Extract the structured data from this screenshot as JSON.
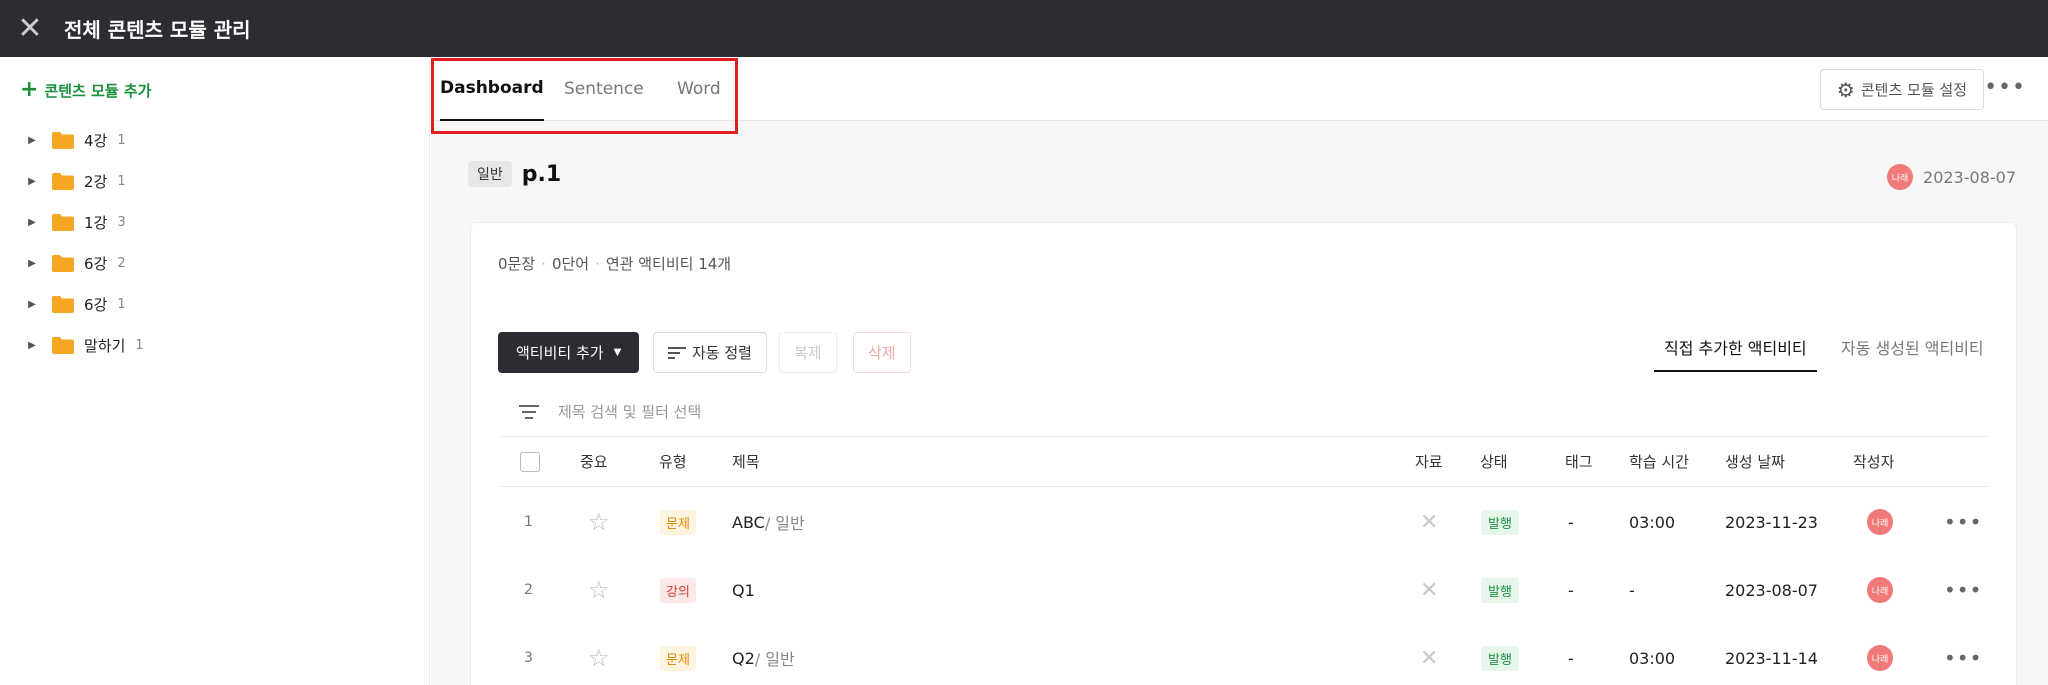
{
  "topbar": {
    "title": "전체 콘텐츠 모듈 관리",
    "close_icon": "close-icon"
  },
  "sidebar": {
    "add_label": "콘텐츠 모듈 추가",
    "items": [
      {
        "label": "4강",
        "count": "1"
      },
      {
        "label": "2강",
        "count": "1"
      },
      {
        "label": "1강",
        "count": "3"
      },
      {
        "label": "6강",
        "count": "2"
      },
      {
        "label": "6강",
        "count": "1"
      },
      {
        "label": "말하기",
        "count": "1"
      }
    ]
  },
  "tabs": [
    {
      "label": "Dashboard",
      "active": true
    },
    {
      "label": "Sentence",
      "active": false
    },
    {
      "label": "Word",
      "active": false
    }
  ],
  "header": {
    "settings_label": "콘텐츠 모듈 설정",
    "badge": "일반",
    "title": "p.1",
    "author_avatar": "나래",
    "date": "2023-08-07"
  },
  "stats": {
    "sentences": "0문장",
    "words": "0단어",
    "activities": "연관 액티비티 14개"
  },
  "toolbar": {
    "add_activity": "액티비티 추가",
    "auto_sort": "자동 정렬",
    "copy": "복제",
    "delete": "삭제",
    "view_direct": "직접 추가한 액티비티",
    "view_auto": "자동 생성된 액티비티"
  },
  "filter": {
    "placeholder": "제목 검색 및 필터 선택"
  },
  "table": {
    "headers": {
      "important": "중요",
      "type": "유형",
      "title": "제목",
      "material": "자료",
      "status": "상태",
      "tag": "태그",
      "study_time": "학습 시간",
      "created": "생성 날짜",
      "author": "작성자"
    },
    "rows": [
      {
        "num": "1",
        "type": "문제",
        "type_kind": "q",
        "title": "ABC",
        "sub": " / 일반",
        "status": "발행",
        "tag": "-",
        "time": "03:00",
        "date": "2023-11-23",
        "author": "나래"
      },
      {
        "num": "2",
        "type": "강의",
        "type_kind": "l",
        "title": "Q1",
        "sub": "",
        "status": "발행",
        "tag": "-",
        "time": "-",
        "date": "2023-08-07",
        "author": "나래"
      },
      {
        "num": "3",
        "type": "문제",
        "type_kind": "q",
        "title": "Q2",
        "sub": " / 일반",
        "status": "발행",
        "tag": "-",
        "time": "03:00",
        "date": "2023-11-14",
        "author": "나래"
      }
    ]
  },
  "colors": {
    "accent_green": "#1a8f3a",
    "dark": "#2b2d33",
    "highlight_red": "#e02020",
    "folder": "#f5a623"
  }
}
